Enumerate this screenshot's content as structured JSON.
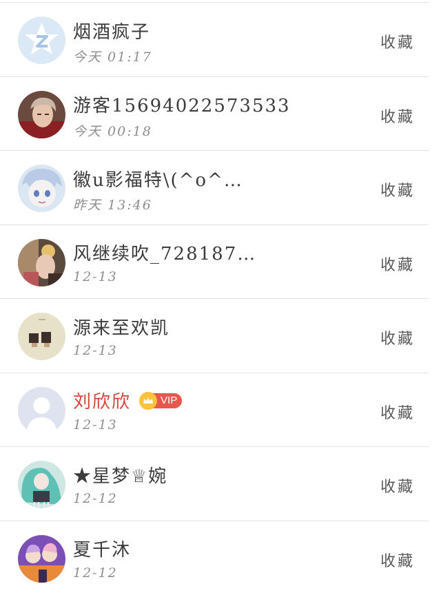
{
  "list": {
    "collect_label": "收藏",
    "vip_label": "VIP",
    "items": [
      {
        "name": "烟酒疯子",
        "time": "今天 01:17",
        "vip": false,
        "avatar": "default-z-avatar"
      },
      {
        "name": "游客15694022573533",
        "time": "今天 00:18",
        "vip": false,
        "avatar": "photo-avatar"
      },
      {
        "name": "徽u影福特\\(^o^…",
        "time": "昨天 13:46",
        "vip": false,
        "avatar": "anime-avatar"
      },
      {
        "name": "风继续吹_728187…",
        "time": "12-13",
        "vip": false,
        "avatar": "photo-avatar"
      },
      {
        "name": "源来至欢凯",
        "time": "12-13",
        "vip": false,
        "avatar": "photo-avatar"
      },
      {
        "name": "刘欣欣",
        "time": "12-13",
        "vip": true,
        "avatar": "default-person-avatar"
      },
      {
        "name": "★星梦♕婉",
        "time": "12-12",
        "vip": false,
        "avatar": "anime-avatar"
      },
      {
        "name": "夏千沐",
        "time": "12-12",
        "vip": false,
        "avatar": "anime-avatar"
      }
    ]
  },
  "colors": {
    "vip_name": "#d9443a",
    "vip_badge": "#e8574e",
    "crown": "#ffc23b",
    "divider": "#e3e3e3"
  }
}
